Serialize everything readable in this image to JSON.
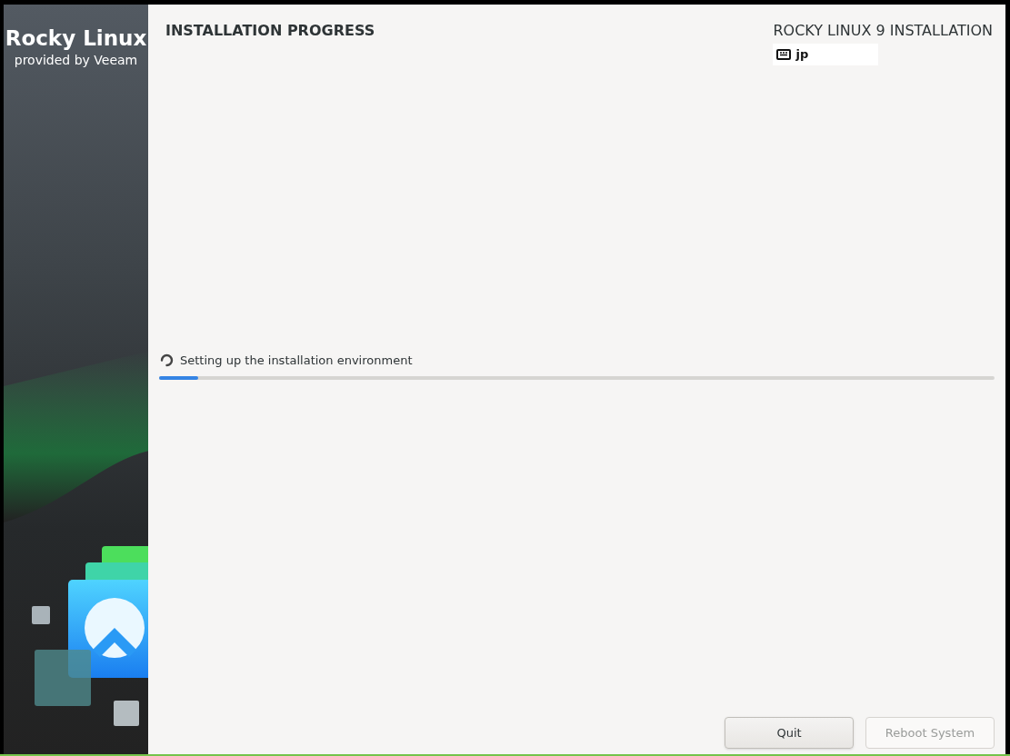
{
  "sidebar": {
    "brand": "Rocky Linux",
    "tagline": "provided by Veeam"
  },
  "header": {
    "title": "INSTALLATION PROGRESS",
    "product": "ROCKY LINUX 9 INSTALLATION",
    "keyboard_layout": "jp"
  },
  "progress": {
    "message": "Setting up the installation environment",
    "level": 0.047
  },
  "buttons": [
    {
      "label": "Quit",
      "disabled": false
    },
    {
      "label": "Reboot System",
      "disabled": true
    }
  ]
}
